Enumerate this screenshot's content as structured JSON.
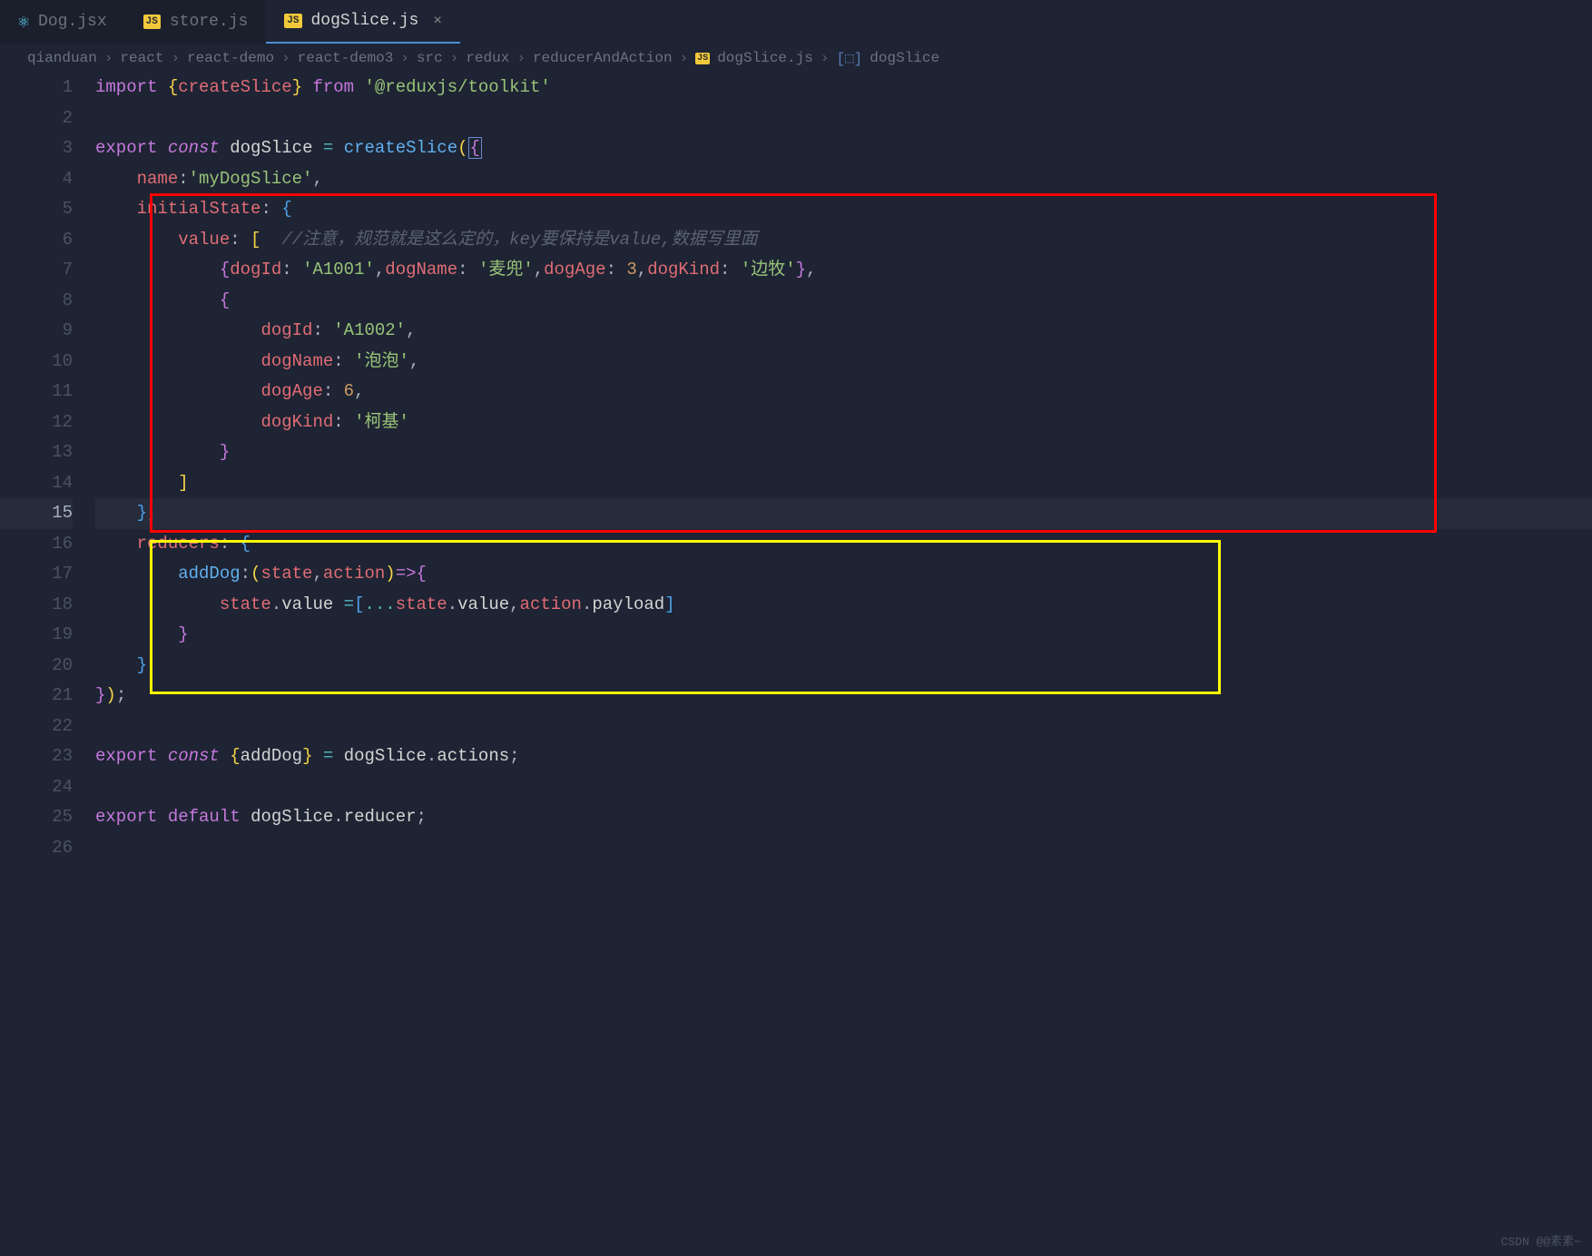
{
  "tabs": [
    {
      "icon": "react",
      "label": "Dog.jsx",
      "active": false,
      "closable": false
    },
    {
      "icon": "js",
      "label": "store.js",
      "active": false,
      "closable": false
    },
    {
      "icon": "js",
      "label": "dogSlice.js",
      "active": true,
      "closable": true
    }
  ],
  "breadcrumb": {
    "parts": [
      "qianduan",
      "react",
      "react-demo",
      "react-demo3",
      "src",
      "redux",
      "reducerAndAction"
    ],
    "file": "dogSlice.js",
    "symbol": "dogSlice",
    "sep": "›"
  },
  "icons": {
    "js": "JS",
    "react": "⚛",
    "close": "×",
    "symbol": "[⬚]"
  },
  "active_line": 15,
  "code": {
    "l1": {
      "import": "import",
      "lb": "{",
      "ident": "createSlice",
      "rb": "}",
      "from": "from",
      "str": "'@reduxjs/toolkit'"
    },
    "l3": {
      "export": "export",
      "const": "const",
      "name": "dogSlice",
      "eq": "=",
      "fn": "createSlice",
      "lp": "(",
      "lb": "{"
    },
    "l4": {
      "key": "name",
      "val": "'myDogSlice'",
      "comma": ","
    },
    "l5": {
      "key": "initialState",
      "lb": "{"
    },
    "l6": {
      "key": "value",
      "lbr": "[",
      "comment": "//注意，规范就是这么定的，key要保持是value,数据写里面"
    },
    "l7": {
      "lb": "{",
      "k1": "dogId",
      "v1": "'A1001'",
      "k2": "dogName",
      "v2": "'麦兜'",
      "k3": "dogAge",
      "v3": "3",
      "k4": "dogKind",
      "v4": "'边牧'",
      "rb": "}"
    },
    "l8": {
      "lb": "{"
    },
    "l9": {
      "k": "dogId",
      "v": "'A1002'",
      "comma": ","
    },
    "l10": {
      "k": "dogName",
      "v": "'泡泡'",
      "comma": ","
    },
    "l11": {
      "k": "dogAge",
      "v": "6",
      "comma": ","
    },
    "l12": {
      "k": "dogKind",
      "v": "'柯基'"
    },
    "l13": {
      "rb": "}"
    },
    "l14": {
      "rbr": "]"
    },
    "l15": {
      "rb": "}",
      "comma": ","
    },
    "l16": {
      "key": "reducers",
      "lb": "{"
    },
    "l17": {
      "fn": "addDog",
      "lp": "(",
      "p1": "state",
      "p2": "action",
      "rp": ")",
      "arrow": "=>",
      "lb": "{"
    },
    "l18": {
      "obj": "state",
      "dot": ".",
      "prop": "value",
      "eq": "=",
      "lbr": "[",
      "spread": "...",
      "o2": "state",
      "p2": "value",
      "o3": "action",
      "p3": "payload",
      "rbr": "]"
    },
    "l19": {
      "rb": "}"
    },
    "l20": {
      "rb": "}"
    },
    "l21": {
      "rb": "}",
      "rp": ")",
      "semi": ";"
    },
    "l23": {
      "export": "export",
      "const": "const",
      "lb": "{",
      "ident": "addDog",
      "rb": "}",
      "eq": "=",
      "obj": "dogSlice",
      "prop": "actions",
      "semi": ";"
    },
    "l25": {
      "export": "export",
      "default": "default",
      "obj": "dogSlice",
      "prop": "reducer",
      "semi": ";"
    }
  },
  "watermark": "CSDN @@素素~"
}
